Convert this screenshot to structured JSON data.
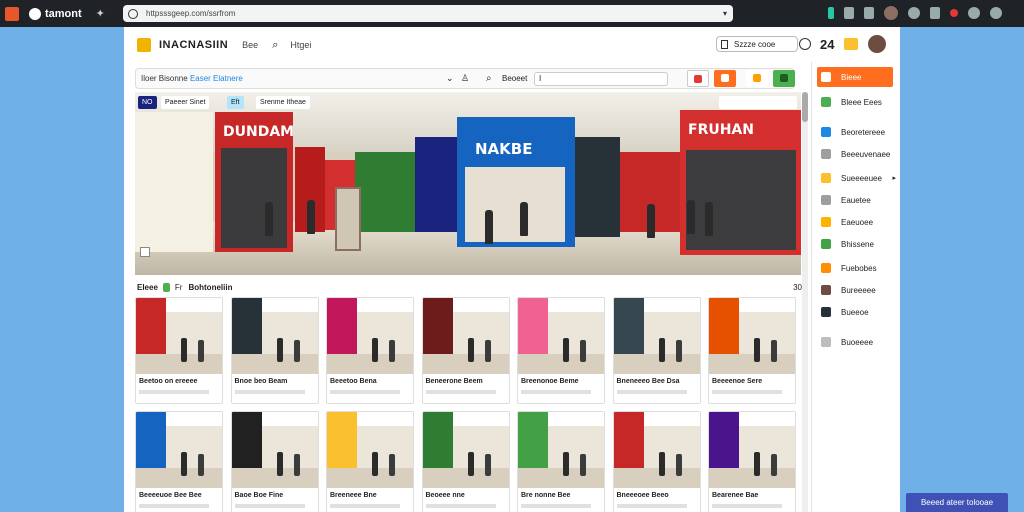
{
  "browser": {
    "brand": "tamont",
    "url": "httpsssgeep.com/ssrfrom",
    "colors": {
      "bar": "#1f2227",
      "accent": "#e8572a"
    }
  },
  "app": {
    "title": "INACNASIIN",
    "nav": [
      "Bee",
      "Htgei"
    ],
    "signin": "Szzze cooe",
    "badge_count": "24"
  },
  "toolbar": {
    "breadcrumb": "Iloer Bisonne",
    "breadcrumb_hl": "Easer Elatnere",
    "sort_label": "Beoeet",
    "search_placeholder": "I"
  },
  "hero": {
    "chips": [
      "NO",
      "Paeeer Sinet",
      "Eft",
      "Srenme Itheae",
      ""
    ],
    "store_sign_left": "DUNDAM",
    "store_sign_center": "NAKBE",
    "store_sign_right": "FRUHAN"
  },
  "section": {
    "title": "Eleee",
    "label2": "Fr",
    "label3": "Bohtoneliin",
    "more": "30"
  },
  "cards": [
    {
      "caption": "Beetoo on ereeee",
      "wall": "#c62828"
    },
    {
      "caption": "Bnoe beo Beam",
      "wall": "#263238"
    },
    {
      "caption": "Beeetoo Bena",
      "wall": "#c2185b"
    },
    {
      "caption": "Beneerone Beem",
      "wall": "#6d1b1b"
    },
    {
      "caption": "Breenonoe Beme",
      "wall": "#f06292"
    },
    {
      "caption": "Bneneeeo Bee Dsa",
      "wall": "#37474f"
    },
    {
      "caption": "Beeeenoe Sere",
      "wall": "#e65100"
    },
    {
      "caption": "Beeeeuoe Bee Bee",
      "wall": "#1565c0"
    },
    {
      "caption": "Baoe Boe Fine",
      "wall": "#212121"
    },
    {
      "caption": "Breeneee Bne",
      "wall": "#fbc02d"
    },
    {
      "caption": "Beoeee nne",
      "wall": "#2e7d32"
    },
    {
      "caption": "Bre nonne Bee",
      "wall": "#43a047"
    },
    {
      "caption": "Bneeeoee Beeo",
      "wall": "#c62828"
    },
    {
      "caption": "Bearenee Bae",
      "wall": "#4a148c"
    }
  ],
  "side_panel": {
    "items": [
      {
        "label": "Bieee",
        "icon": "home-icon",
        "color": "#ff6d1f"
      },
      {
        "label": "Bleee Eees",
        "icon": "green-tag-icon",
        "color": "#4caf50"
      },
      {
        "label": "Beoretereee",
        "icon": "grid-icon",
        "color": "#1e88e5"
      },
      {
        "label": "Beeeuvenaee",
        "icon": "list-icon",
        "color": "#9e9e9e"
      },
      {
        "label": "Sueeeeuee",
        "icon": "folder-icon",
        "color": "#fbc02d"
      },
      {
        "label": "Eauetee",
        "icon": "box-icon",
        "color": "#9e9e9e"
      },
      {
        "label": "Eaeuoee",
        "icon": "cone-icon",
        "color": "#ffb300"
      },
      {
        "label": "Bhissene",
        "icon": "leaf-icon",
        "color": "#43a047"
      },
      {
        "label": "Fuebobes",
        "icon": "bag-icon",
        "color": "#ff8f00"
      },
      {
        "label": "Bureeeee",
        "icon": "cart-icon",
        "color": "#6d4c41"
      },
      {
        "label": "Bueeoe",
        "icon": "dark-icon",
        "color": "#263238"
      },
      {
        "label": "Buoeeee",
        "icon": "doc-icon",
        "color": "#bdbdbd"
      }
    ]
  },
  "float_button": "Beeed ateer tolooae"
}
